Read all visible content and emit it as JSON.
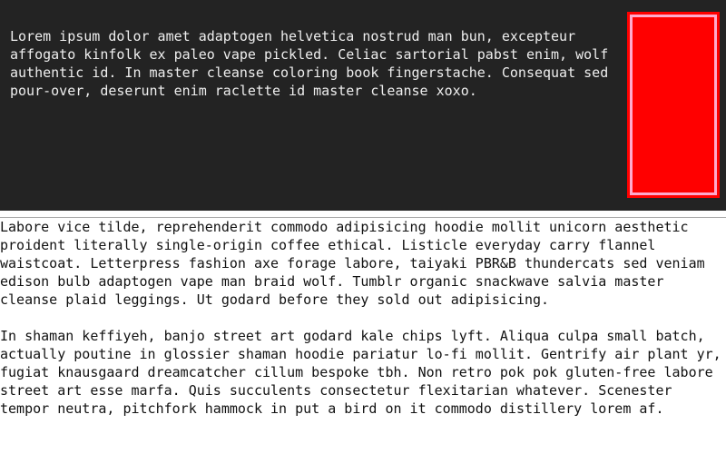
{
  "hero": {
    "paragraph": "Lorem ipsum dolor amet adaptogen helvetica nostrud man bun, excepteur affogato kinfolk ex paleo vape pickled. Celiac sartorial pabst enim, wolf authentic id. In master cleanse coloring book fingerstache. Consequat sed pour-over, deserunt enim raclette id master cleanse xoxo.",
    "callout": {
      "label": "",
      "fill_color": "#ff0000",
      "inner_border_color": "#ffaacc",
      "outer_border_color": "#ff0000"
    },
    "background_color": "#232323",
    "text_color": "#eeeeee"
  },
  "divider": {
    "color": "#a9a9a9"
  },
  "body": {
    "paragraphs": [
      "Labore vice tilde, reprehenderit commodo adipisicing hoodie mollit unicorn aesthetic proident literally single-origin coffee ethical. Listicle everyday carry flannel waistcoat. Letterpress fashion axe forage labore, taiyaki PBR&B thundercats sed veniam edison bulb adaptogen vape man braid wolf. Tumblr organic snackwave salvia master cleanse plaid leggings. Ut godard before they sold out adipisicing.",
      "In shaman keffiyeh, banjo street art godard kale chips lyft. Aliqua culpa small batch, actually poutine in glossier shaman hoodie pariatur lo-fi mollit. Gentrify air plant yr, fugiat knausgaard dreamcatcher cillum bespoke tbh. Non retro pok pok gluten-free labore street art esse marfa. Quis succulents consectetur flexitarian whatever. Scenester tempor neutra, pitchfork hammock in put a bird on it commodo distillery lorem af."
    ],
    "text_color": "#111111"
  }
}
